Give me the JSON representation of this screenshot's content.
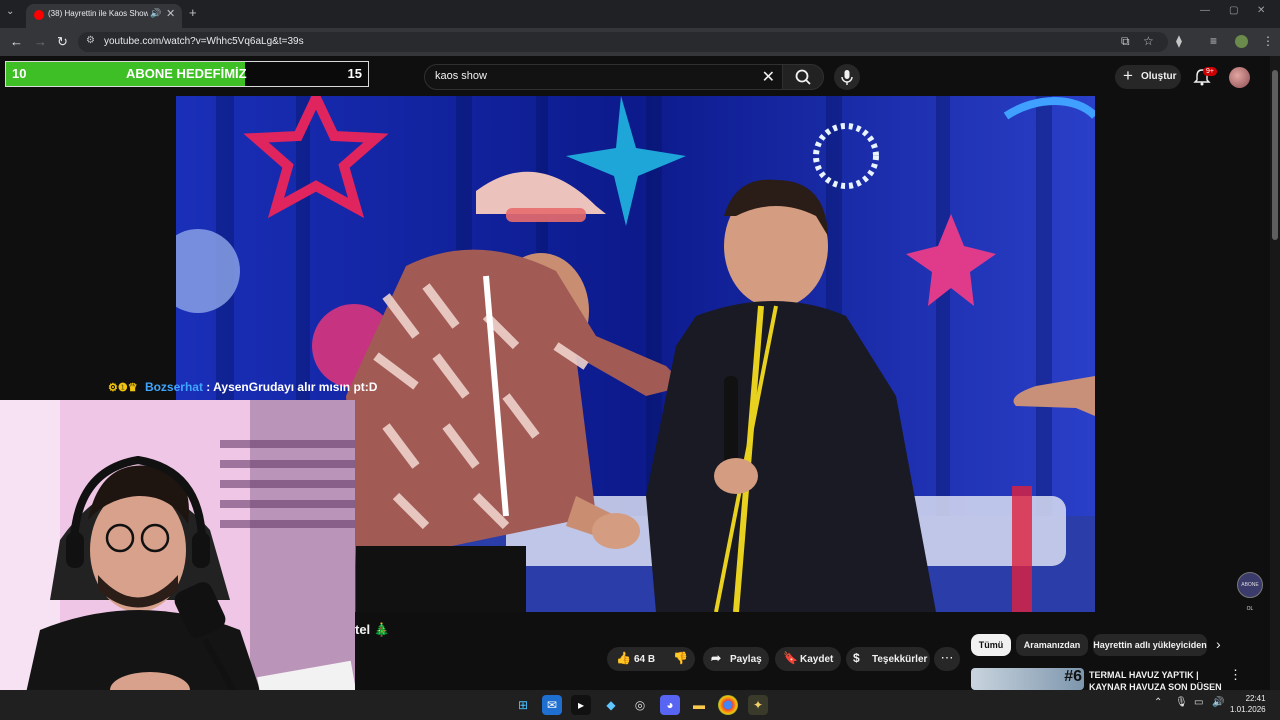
{
  "browser": {
    "tab_title": "(38) Hayrettin ile Kaos Show",
    "url": "youtube.com/watch?v=Whhc5Vq6aLg&t=39s"
  },
  "youtube": {
    "search_query": "kaos show",
    "create_label": "Oluştur",
    "notification_badge": "9+",
    "video_title_visible": "tel 🎄",
    "actions": {
      "likes": "64 B",
      "share": "Paylaş",
      "save": "Kaydet",
      "thanks": "Teşekkürler"
    },
    "chips": [
      "Tümü",
      "Aramanızdan",
      "Hayrettin adlı yükleyiciden"
    ],
    "recommended": {
      "title": "TERMAL HAVUZ YAPTIK | KAYNAR HAVUZA SON DÜŞEN",
      "thumb_label": "#6"
    },
    "watermark": "ABONE OL"
  },
  "overlay": {
    "goal": {
      "start": "10",
      "label": "ABONE HEDEFİMİZ",
      "end": "15",
      "progress": 0.66
    },
    "chat": {
      "user": "Bozserhat",
      "message": ": AysenGrudayı alır mısın pt:D"
    }
  },
  "taskbar": {
    "time": "22:41",
    "date": "1.01.2026"
  },
  "colors": {
    "youtube_red": "#ff0000",
    "goal_green": "#3fbf26",
    "chat_user": "#3ea6ff"
  }
}
